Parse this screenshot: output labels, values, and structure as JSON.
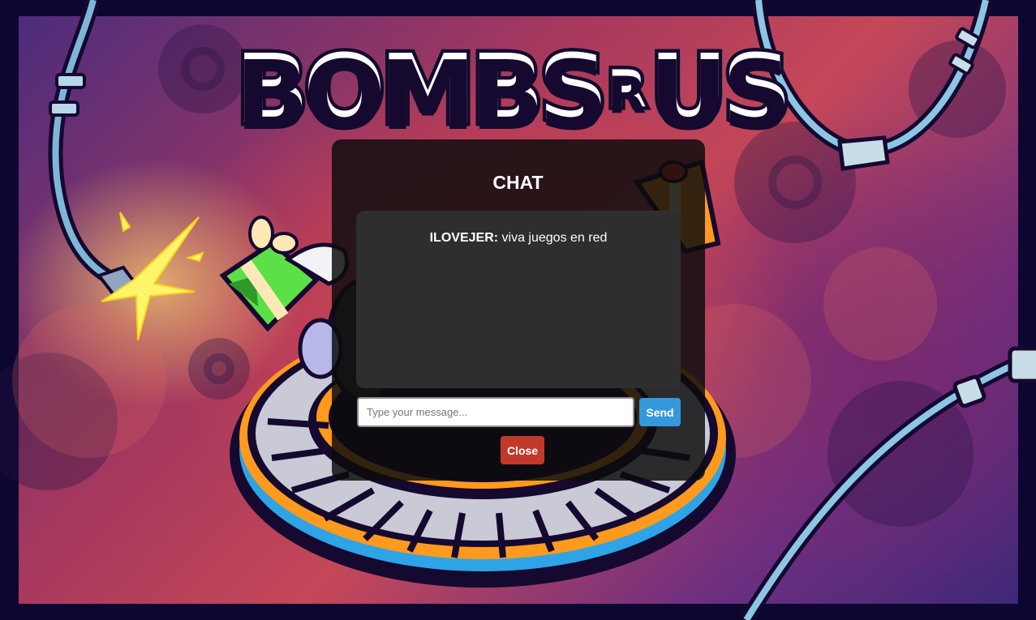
{
  "logo": {
    "word_1": "BOMBS",
    "word_2": "R",
    "word_3": "US"
  },
  "chat": {
    "title": "CHAT",
    "messages": [
      {
        "sender": "ILOVEJER:",
        "text": " viva juegos en red"
      }
    ],
    "input": {
      "value": "",
      "placeholder": "Type your message..."
    },
    "send_label": "Send",
    "close_label": "Close"
  },
  "colors": {
    "frame": "#0c0630",
    "send_button": "#3498db",
    "close_button": "#c0392b",
    "message_area": "#2e2e2e"
  }
}
